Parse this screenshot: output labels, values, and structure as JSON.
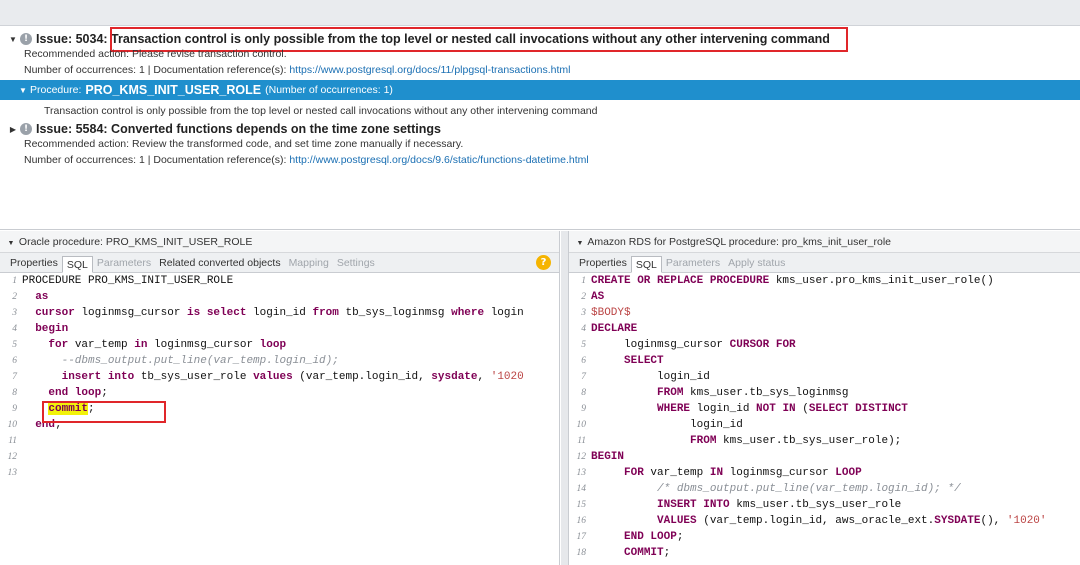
{
  "issues": [
    {
      "title": "Issue: 5034: Transaction control is only possible from the top level or nested call invocations without any other intervening command",
      "recommended": "Recommended action: Please revise transaction control.",
      "occurrences_prefix": "Number of occurrences: 1 | Documentation reference(s): ",
      "doc_link": "https://www.postgresql.org/docs/11/plpgsql-transactions.html"
    },
    {
      "title": "Issue: 5584: Converted functions depends on the time zone settings",
      "recommended": "Recommended action: Review the transformed code, and set time zone manually if necessary.",
      "occurrences_prefix": "Number of occurrences: 1 | Documentation reference(s): ",
      "doc_link": "http://www.postgresql.org/docs/9.6/static/functions-datetime.html"
    }
  ],
  "procedure_row": {
    "label": "Procedure:",
    "name": "PRO_KMS_INIT_USER_ROLE",
    "count": "(Number of occurrences: 1)",
    "message": "Transaction control is only possible from the top level or nested call invocations without any other intervening command"
  },
  "left_pane": {
    "title": "Oracle procedure: PRO_KMS_INIT_USER_ROLE",
    "tabs": [
      "Properties",
      "SQL",
      "Parameters",
      "Related converted objects",
      "Mapping",
      "Settings"
    ],
    "active_tab": "SQL",
    "line_numbers": [
      "1",
      "2",
      "3",
      "4",
      "5",
      "6",
      "7",
      "8",
      "9",
      "10",
      "11",
      "12",
      "13"
    ]
  },
  "right_pane": {
    "title": "Amazon RDS for PostgreSQL procedure: pro_kms_init_user_role",
    "tabs": [
      "Properties",
      "SQL",
      "Parameters",
      "Apply status"
    ],
    "active_tab": "SQL",
    "line_numbers": [
      "1",
      "2",
      "3",
      "4",
      "5",
      "6",
      "7",
      "8",
      "9",
      "10",
      "11",
      "12",
      "13",
      "14",
      "15",
      "16",
      "17",
      "18"
    ]
  },
  "oracle_code": {
    "l1": "PROCEDURE PRO_KMS_INIT_USER_ROLE",
    "l2_kw": "as",
    "l3_kw1": "cursor",
    "l3_a": " loginmsg_cursor ",
    "l3_kw2": "is select",
    "l3_b": " login_id ",
    "l3_kw3": "from",
    "l3_c": " tb_sys_loginmsg ",
    "l3_kw4": "where",
    "l3_d": " login",
    "l4_kw": "begin",
    "l5_kw1": "for",
    "l5_a": " var_temp ",
    "l5_kw2": "in",
    "l5_b": " loginmsg_cursor ",
    "l5_kw3": "loop",
    "l6_cm": "--dbms_output.put_line(var_temp.login_id);",
    "l7_kw1": "insert into",
    "l7_a": " tb_sys_user_role ",
    "l7_kw2": "values",
    "l7_b": " (var_temp.login_id, ",
    "l7_fn": "sysdate",
    "l7_c": ", ",
    "l7_str": "'1020",
    "l8_kw": "end loop",
    "l8_semi": ";",
    "l9_kw": "commit",
    "l9_semi": ";",
    "l10_kw": "end",
    "l10_semi": ";"
  },
  "pg_code": {
    "l1_kw": "CREATE OR REPLACE PROCEDURE",
    "l1_a": " kms_user.pro_kms_init_user_role()",
    "l2_kw": "AS",
    "l3_str": "$BODY$",
    "l4_kw": "DECLARE",
    "l5_a": "loginmsg_cursor ",
    "l5_kw": "CURSOR FOR",
    "l6_kw": "SELECT",
    "l7_a": "login_id",
    "l8_kw": "FROM",
    "l8_a": " kms_user.tb_sys_loginmsg",
    "l9_kw1": "WHERE",
    "l9_a": " login_id ",
    "l9_kw2": "NOT IN",
    "l9_b": " (",
    "l9_kw3": "SELECT DISTINCT",
    "l10_a": "login_id",
    "l11_kw": "FROM",
    "l11_a": " kms_user.tb_sys_user_role);",
    "l12_kw": "BEGIN",
    "l13_kw1": "FOR",
    "l13_a": " var_temp ",
    "l13_kw2": "IN",
    "l13_b": " loginmsg_cursor ",
    "l13_kw3": "LOOP",
    "l14_cm": "/* dbms_output.put_line(var_temp.login_id); */",
    "l15_kw": "INSERT INTO",
    "l15_a": " kms_user.tb_sys_user_role",
    "l16_kw": "VALUES",
    "l16_a": " (var_temp.login_id, aws_oracle_ext.",
    "l16_fn": "SYSDATE",
    "l16_b": "(), ",
    "l16_str": "'1020'",
    "l17_kw": "END LOOP",
    "l17_a": ";",
    "l18_kw": "COMMIT",
    "l18_a": ";"
  },
  "colors": {
    "selected_row": "#1f8fcd",
    "highlight_box": "#e0262a",
    "link": "#1a6fb3",
    "keyword": "#7f0055"
  },
  "icons": {
    "expand": "triangle-down-icon",
    "collapse": "triangle-right-icon",
    "info": "info-circle-icon",
    "help": "help-circle-icon"
  }
}
